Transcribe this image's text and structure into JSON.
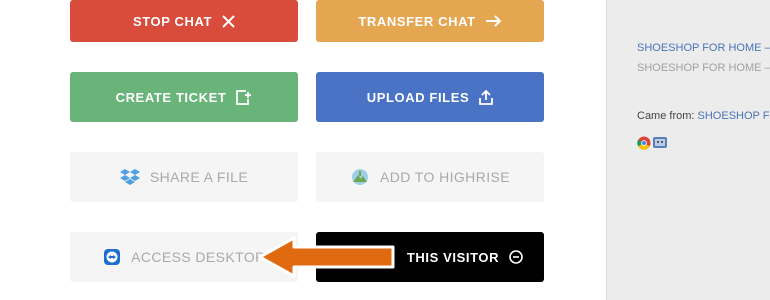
{
  "actions": {
    "stop_chat": "STOP CHAT",
    "transfer_chat": "TRANSFER CHAT",
    "create_ticket": "CREATE TICKET",
    "upload_files": "UPLOAD FILES",
    "share_file": "SHARE A FILE",
    "add_to_highrise": "ADD TO HIGHRISE",
    "access_desktop": "ACCESS DESKTOP",
    "ban_visitor": "THIS VISITOR"
  },
  "colors": {
    "stop": "#d94c3c",
    "transfer": "#e5a651",
    "create": "#68b479",
    "upload": "#4a73c6",
    "ban": "#000000",
    "callout": "#e06a10"
  },
  "icons": {
    "stop": "close-icon",
    "transfer": "arrow-right-icon",
    "create": "new-document-icon",
    "upload": "upload-icon",
    "share": "dropbox-icon",
    "highrise": "highrise-icon",
    "access": "teamviewer-icon",
    "ban": "minus-circle-icon"
  },
  "sidebar": {
    "link_1": "SHOESHOP FOR HOME – E",
    "link_2": "SHOESHOP FOR HOME – E",
    "came_from_label": "Came from:",
    "came_from_link": "SHOESHOP FO",
    "browser_icons": [
      "chrome-icon",
      "mac-os-icon"
    ]
  }
}
